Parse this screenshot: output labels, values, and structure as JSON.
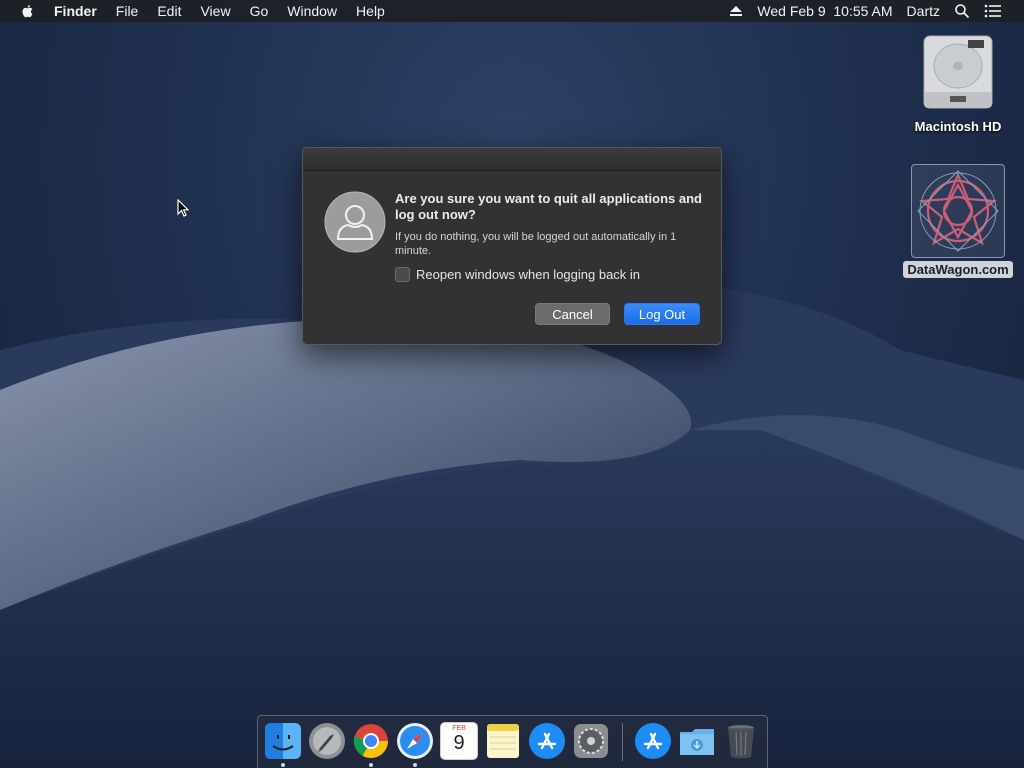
{
  "menubar": {
    "app_name": "Finder",
    "menus": [
      "File",
      "Edit",
      "View",
      "Go",
      "Window",
      "Help"
    ],
    "datetime": "Wed Feb 9  10:55 AM",
    "user": "Dartz"
  },
  "desktop": {
    "icons": [
      {
        "label": "Macintosh HD",
        "icon": "hard-drive-icon"
      },
      {
        "label": "DataWagon.com",
        "icon": "datawagon-image-icon"
      }
    ]
  },
  "dialog": {
    "title": "Are you sure you want to quit all applications and log out now?",
    "message": "If you do nothing, you will be logged out automatically in 1 minute.",
    "checkbox_label": "Reopen windows when logging back in",
    "checkbox_checked": false,
    "cancel_label": "Cancel",
    "logout_label": "Log Out",
    "accent_color": "#1a6ee6"
  },
  "dock": {
    "apps": [
      {
        "name": "Finder",
        "icon": "finder-icon",
        "running": true
      },
      {
        "name": "Launchpad",
        "icon": "launchpad-icon",
        "running": false
      },
      {
        "name": "Google Chrome",
        "icon": "chrome-icon",
        "running": true
      },
      {
        "name": "Safari",
        "icon": "safari-icon",
        "running": true
      },
      {
        "name": "Calendar",
        "icon": "calendar-icon",
        "running": false,
        "month": "FEB",
        "day": "9"
      },
      {
        "name": "Notes",
        "icon": "notes-icon",
        "running": false
      },
      {
        "name": "App Store",
        "icon": "app-store-icon",
        "running": false
      },
      {
        "name": "System Preferences",
        "icon": "system-preferences-icon",
        "running": false
      },
      {
        "name": "App Store",
        "icon": "app-store-icon",
        "running": false
      },
      {
        "name": "Downloads",
        "icon": "downloads-folder-icon",
        "running": false
      },
      {
        "name": "Trash",
        "icon": "trash-icon",
        "running": false
      }
    ]
  }
}
